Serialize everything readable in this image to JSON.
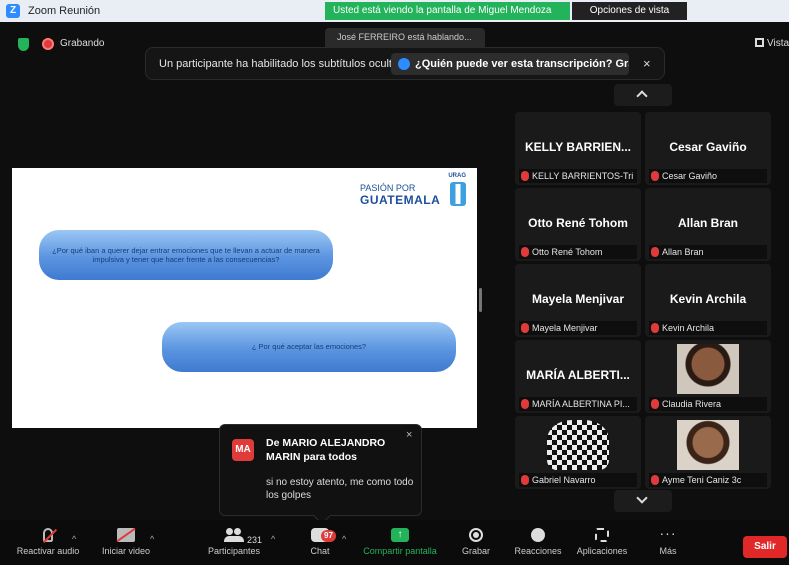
{
  "window": {
    "title": "Zoom Reunión",
    "app_icon": "zoom-icon",
    "share_banner": "Usted está viendo la pantalla de Miguel Mendoza",
    "view_options": "Opciones de vista"
  },
  "meeting_bar": {
    "recording_label": "Grabando",
    "speaking": "José FERREIRO está hablando...",
    "view_label": "Vista"
  },
  "caption_notice": {
    "message": "Un participante ha habilitado los subtítulos ocultos",
    "who_can_see": "¿Quién puede ver esta transcripción? Gra...",
    "close": "×"
  },
  "slide": {
    "logo_tag": "URAG",
    "logo_line1": "PASIÓN POR",
    "logo_line2": "GUATEMALA",
    "question_1": "¿Por qué iban a querer dejar entrar emociones que te llevan a actuar de manera impulsiva y tener que hacer frente a las consecuencias?",
    "question_2": "¿ Por qué aceptar las emociones?"
  },
  "gallery": {
    "tiles": [
      {
        "name": "KELLY BARRIEN...",
        "label": "KELLY BARRIENTOS-Tri"
      },
      {
        "name": "Cesar Gaviño",
        "label": "Cesar Gaviño"
      },
      {
        "name": "Otto René Tohom",
        "label": "Otto René Tohom"
      },
      {
        "name": "Allan Bran",
        "label": "Allan Bran"
      },
      {
        "name": "Mayela Menjivar",
        "label": "Mayela Menjivar"
      },
      {
        "name": "Kevin Archila",
        "label": "Kevin Archila"
      },
      {
        "name": "MARÍA ALBERTI...",
        "label": "MARÍA ALBERTINA PI..."
      },
      {
        "name": "",
        "label": "Claudia Rivera"
      },
      {
        "name": "",
        "label": "Gabriel Navarro"
      },
      {
        "name": "",
        "label": "Ayme Teni Caniz 3c"
      }
    ]
  },
  "chat_toast": {
    "avatar": "MA",
    "from": "De MARIO ALEJANDRO MARIN para todos",
    "message": "si no estoy atento, me como todo los golpes",
    "close": "×"
  },
  "toolbar": {
    "audio": "Reactivar audio",
    "video": "Iniciar video",
    "participants": "Participantes",
    "participant_count": "231",
    "chat": "Chat",
    "chat_badge": "97",
    "share": "Compartir pantalla",
    "record": "Grabar",
    "reactions": "Reacciones",
    "apps": "Aplicaciones",
    "more": "Más",
    "leave": "Salir"
  },
  "colors": {
    "accent_green": "#23b35b",
    "leave_red": "#e02828",
    "zoom_blue": "#2d8cff"
  }
}
